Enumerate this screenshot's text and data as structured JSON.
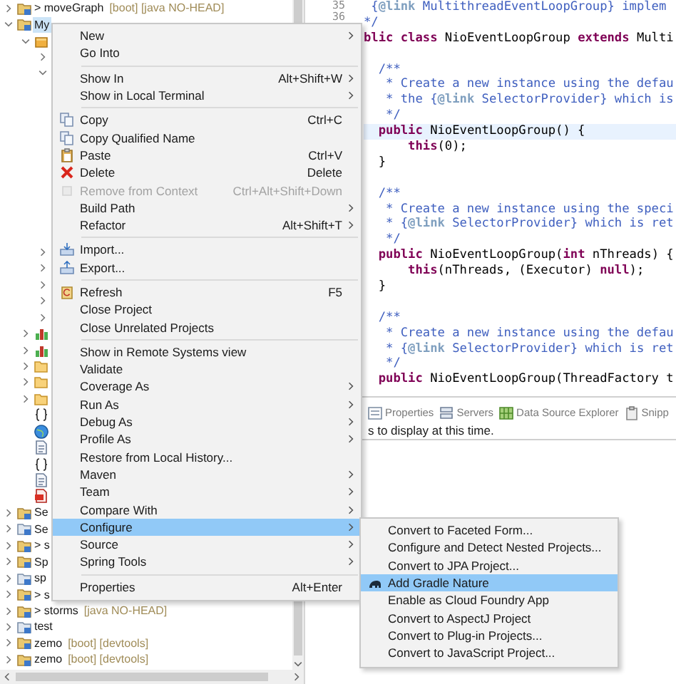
{
  "tree_top": [
    {
      "kind": "project",
      "label": "> moveGraph",
      "decoration": "[boot] [java NO-HEAD]",
      "expanded": false,
      "selected": false
    },
    {
      "kind": "project",
      "label": "My",
      "expanded": true,
      "selected": true,
      "children": [
        {
          "kind": "package",
          "expanded": true,
          "selected": false,
          "children": [
            {
              "expanded": false,
              "selected": false
            },
            {
              "expanded": true,
              "selected": false
            }
          ]
        }
      ]
    }
  ],
  "tree_bottom": [
    {
      "kind": "continued",
      "children": [
        {
          "kind": "continued",
          "children": [
            {
              "expanded": false,
              "selected": false
            },
            {
              "expanded": false,
              "selected": false
            },
            {
              "expanded": false,
              "selected": false
            },
            {
              "expanded": false,
              "selected": false
            },
            {
              "expanded": false,
              "selected": false
            }
          ]
        },
        {
          "kind": "chart",
          "expanded": false,
          "selected": false
        },
        {
          "kind": "chart",
          "expanded": false,
          "selected": false
        },
        {
          "kind": "folder",
          "expanded": false,
          "selected": false
        },
        {
          "kind": "folder",
          "expanded": false,
          "selected": false
        },
        {
          "kind": "folder",
          "expanded": false,
          "selected": false
        },
        {
          "kind": "braces",
          "selected": false
        },
        {
          "kind": "globe",
          "selected": false
        },
        {
          "kind": "file",
          "selected": false
        },
        {
          "kind": "braces",
          "selected": false
        },
        {
          "kind": "file",
          "selected": false
        },
        {
          "kind": "pdf",
          "selected": false
        }
      ]
    },
    {
      "kind": "project",
      "label": "Se",
      "expanded": false,
      "selected": false
    },
    {
      "kind": "project-alt",
      "label": "Se",
      "expanded": false,
      "selected": false
    },
    {
      "kind": "project",
      "label": "> s",
      "expanded": false,
      "selected": false
    },
    {
      "kind": "project",
      "label": "Sp",
      "expanded": false,
      "selected": false
    },
    {
      "kind": "project-alt",
      "label": "sp",
      "expanded": false,
      "selected": false
    },
    {
      "kind": "project",
      "label": "> s",
      "expanded": false,
      "selected": false
    },
    {
      "kind": "project",
      "label": "> storms",
      "decoration": "[java NO-HEAD]",
      "expanded": false,
      "selected": false
    },
    {
      "kind": "project-alt",
      "label": "test",
      "expanded": false,
      "selected": false
    },
    {
      "kind": "project",
      "label": "zemo",
      "decoration": "[boot] [devtools]",
      "expanded": false,
      "selected": false
    },
    {
      "kind": "project",
      "label": "zemo",
      "decoration": "[boot] [devtools]",
      "expanded": false,
      "selected": false
    }
  ],
  "line_numbers": [
    "35",
    "36"
  ],
  "code": [
    {
      "kind": "code",
      "current": false,
      "segments": [
        {
          "t": " {",
          "kind": "javadoc"
        },
        {
          "t": "@link",
          "kind": "javadoc-tag"
        },
        {
          "t": " MultithreadEventLoopGroup} implem",
          "kind": "javadoc"
        }
      ]
    },
    {
      "kind": "code",
      "current": false,
      "segments": [
        {
          "t": "*/",
          "kind": "javadoc"
        }
      ]
    },
    {
      "kind": "code",
      "current": false,
      "segments": [
        {
          "t": "blic",
          "kind": "keyword"
        },
        {
          "t": " class",
          "kind": "keyword"
        },
        {
          "t": " NioEventLoopGroup ",
          "kind": "plain"
        },
        {
          "t": "extends",
          "kind": "keyword"
        },
        {
          "t": " Multi",
          "kind": "plain"
        }
      ]
    },
    {
      "kind": "blank"
    },
    {
      "kind": "code",
      "current": false,
      "segments": [
        {
          "t": "  /**",
          "kind": "javadoc"
        }
      ]
    },
    {
      "kind": "code",
      "current": false,
      "segments": [
        {
          "t": "   * Create a new instance using the defau",
          "kind": "javadoc"
        }
      ]
    },
    {
      "kind": "code",
      "current": false,
      "segments": [
        {
          "t": "   * the {",
          "kind": "javadoc"
        },
        {
          "t": "@link",
          "kind": "javadoc-tag"
        },
        {
          "t": " SelectorProvider} which is",
          "kind": "javadoc"
        }
      ]
    },
    {
      "kind": "code",
      "current": false,
      "segments": [
        {
          "t": "   */",
          "kind": "javadoc"
        }
      ]
    },
    {
      "kind": "code",
      "current": true,
      "segments": [
        {
          "t": "  public",
          "kind": "keyword"
        },
        {
          "t": " NioEventLoopGroup() {",
          "kind": "plain"
        }
      ]
    },
    {
      "kind": "code",
      "current": false,
      "segments": [
        {
          "t": "      this",
          "kind": "keyword"
        },
        {
          "t": "(0);",
          "kind": "plain"
        }
      ]
    },
    {
      "kind": "code",
      "current": false,
      "segments": [
        {
          "t": "  }",
          "kind": "plain"
        }
      ]
    },
    {
      "kind": "blank"
    },
    {
      "kind": "code",
      "current": false,
      "segments": [
        {
          "t": "  /**",
          "kind": "javadoc"
        }
      ]
    },
    {
      "kind": "code",
      "current": false,
      "segments": [
        {
          "t": "   * Create a new instance using the speci",
          "kind": "javadoc"
        }
      ]
    },
    {
      "kind": "code",
      "current": false,
      "segments": [
        {
          "t": "   * {",
          "kind": "javadoc"
        },
        {
          "t": "@link",
          "kind": "javadoc-tag"
        },
        {
          "t": " SelectorProvider} which is ret",
          "kind": "javadoc"
        }
      ]
    },
    {
      "kind": "code",
      "current": false,
      "segments": [
        {
          "t": "   */",
          "kind": "javadoc"
        }
      ]
    },
    {
      "kind": "code",
      "current": false,
      "segments": [
        {
          "t": "  public",
          "kind": "keyword"
        },
        {
          "t": " NioEventLoopGroup(",
          "kind": "plain"
        },
        {
          "t": "int",
          "kind": "keyword"
        },
        {
          "t": " nThreads) {",
          "kind": "plain"
        }
      ]
    },
    {
      "kind": "code",
      "current": false,
      "segments": [
        {
          "t": "      this",
          "kind": "keyword"
        },
        {
          "t": "(nThreads, (Executor) ",
          "kind": "plain"
        },
        {
          "t": "null",
          "kind": "keyword"
        },
        {
          "t": ");",
          "kind": "plain"
        }
      ]
    },
    {
      "kind": "code",
      "current": false,
      "segments": [
        {
          "t": "  }",
          "kind": "plain"
        }
      ]
    },
    {
      "kind": "blank"
    },
    {
      "kind": "code",
      "current": false,
      "segments": [
        {
          "t": "  /**",
          "kind": "javadoc"
        }
      ]
    },
    {
      "kind": "code",
      "current": false,
      "segments": [
        {
          "t": "   * Create a new instance using the defau",
          "kind": "javadoc"
        }
      ]
    },
    {
      "kind": "code",
      "current": false,
      "segments": [
        {
          "t": "   * {",
          "kind": "javadoc"
        },
        {
          "t": "@link",
          "kind": "javadoc-tag"
        },
        {
          "t": " SelectorProvider} which is ret",
          "kind": "javadoc"
        }
      ]
    },
    {
      "kind": "code",
      "current": false,
      "segments": [
        {
          "t": "   */",
          "kind": "javadoc"
        }
      ]
    },
    {
      "kind": "code",
      "current": false,
      "segments": [
        {
          "t": "  public",
          "kind": "keyword"
        },
        {
          "t": " NioEventLoopGroup(ThreadFactory t",
          "kind": "plain"
        }
      ]
    }
  ],
  "bottom_panel": {
    "tabs": [
      {
        "kind": "properties",
        "label": "Properties",
        "selected": false
      },
      {
        "kind": "servers",
        "label": "Servers",
        "selected": false
      },
      {
        "kind": "datasource",
        "label": "Data Source Explorer",
        "selected": false
      },
      {
        "kind": "snippets",
        "label": "Snipp",
        "selected": false
      }
    ],
    "message": "s to display at this time."
  },
  "context_menu": [
    {
      "kind": "item",
      "label": "New",
      "submenu": true,
      "selected": false,
      "disabled": false
    },
    {
      "kind": "item",
      "label": "Go Into",
      "submenu": false,
      "selected": false,
      "disabled": false
    },
    {
      "kind": "separator"
    },
    {
      "kind": "item",
      "label": "Show In",
      "shortcut": "Alt+Shift+W",
      "submenu": true,
      "selected": false,
      "disabled": false
    },
    {
      "kind": "item",
      "label": "Show in Local Terminal",
      "submenu": true,
      "selected": false,
      "disabled": false
    },
    {
      "kind": "separator"
    },
    {
      "kind": "copy",
      "label": "Copy",
      "shortcut": "Ctrl+C",
      "submenu": false,
      "selected": false,
      "disabled": false
    },
    {
      "kind": "copy",
      "label": "Copy Qualified Name",
      "submenu": false,
      "selected": false,
      "disabled": false
    },
    {
      "kind": "paste",
      "label": "Paste",
      "shortcut": "Ctrl+V",
      "submenu": false,
      "selected": false,
      "disabled": false
    },
    {
      "kind": "delete",
      "label": "Delete",
      "shortcut": "Delete",
      "submenu": false,
      "selected": false,
      "disabled": false
    },
    {
      "kind": "remove",
      "label": "Remove from Context",
      "shortcut": "Ctrl+Alt+Shift+Down",
      "submenu": false,
      "selected": false,
      "disabled": true
    },
    {
      "kind": "item",
      "label": "Build Path",
      "submenu": true,
      "selected": false,
      "disabled": false
    },
    {
      "kind": "item",
      "label": "Refactor",
      "shortcut": "Alt+Shift+T",
      "submenu": true,
      "selected": false,
      "disabled": false
    },
    {
      "kind": "separator"
    },
    {
      "kind": "import",
      "label": "Import...",
      "submenu": false,
      "selected": false,
      "disabled": false
    },
    {
      "kind": "export",
      "label": "Export...",
      "submenu": false,
      "selected": false,
      "disabled": false
    },
    {
      "kind": "separator"
    },
    {
      "kind": "refresh",
      "label": "Refresh",
      "shortcut": "F5",
      "submenu": false,
      "selected": false,
      "disabled": false
    },
    {
      "kind": "item",
      "label": "Close Project",
      "submenu": false,
      "selected": false,
      "disabled": false
    },
    {
      "kind": "item",
      "label": "Close Unrelated Projects",
      "submenu": false,
      "selected": false,
      "disabled": false
    },
    {
      "kind": "separator"
    },
    {
      "kind": "item",
      "label": "Show in Remote Systems view",
      "submenu": false,
      "selected": false,
      "disabled": false
    },
    {
      "kind": "item",
      "label": "Validate",
      "submenu": false,
      "selected": false,
      "disabled": false
    },
    {
      "kind": "item",
      "label": "Coverage As",
      "submenu": true,
      "selected": false,
      "disabled": false
    },
    {
      "kind": "item",
      "label": "Run As",
      "submenu": true,
      "selected": false,
      "disabled": false
    },
    {
      "kind": "item",
      "label": "Debug As",
      "submenu": true,
      "selected": false,
      "disabled": false
    },
    {
      "kind": "item",
      "label": "Profile As",
      "submenu": true,
      "selected": false,
      "disabled": false
    },
    {
      "kind": "item",
      "label": "Restore from Local History...",
      "submenu": false,
      "selected": false,
      "disabled": false
    },
    {
      "kind": "item",
      "label": "Maven",
      "submenu": true,
      "selected": false,
      "disabled": false
    },
    {
      "kind": "item",
      "label": "Team",
      "submenu": true,
      "selected": false,
      "disabled": false
    },
    {
      "kind": "item",
      "label": "Compare With",
      "submenu": true,
      "selected": false,
      "disabled": false
    },
    {
      "kind": "item",
      "label": "Configure",
      "submenu": true,
      "selected": true,
      "disabled": false
    },
    {
      "kind": "item",
      "label": "Source",
      "submenu": true,
      "selected": false,
      "disabled": false
    },
    {
      "kind": "item",
      "label": "Spring Tools",
      "submenu": true,
      "selected": false,
      "disabled": false
    },
    {
      "kind": "separator"
    },
    {
      "kind": "item",
      "label": "Properties",
      "shortcut": "Alt+Enter",
      "submenu": false,
      "selected": false,
      "disabled": false
    }
  ],
  "configure_submenu": [
    {
      "kind": "item",
      "label": "Convert to Faceted Form...",
      "selected": false
    },
    {
      "kind": "item",
      "label": "Configure and Detect Nested Projects...",
      "selected": false
    },
    {
      "kind": "item",
      "label": "Convert to JPA Project...",
      "selected": false
    },
    {
      "kind": "gradle",
      "label": "Add Gradle Nature",
      "selected": true
    },
    {
      "kind": "item",
      "label": "Enable as Cloud Foundry App",
      "selected": false
    },
    {
      "kind": "item",
      "label": "Convert to AspectJ Project",
      "selected": false
    },
    {
      "kind": "item",
      "label": "Convert to Plug-in Projects...",
      "selected": false
    },
    {
      "kind": "item",
      "label": "Convert to JavaScript Project...",
      "selected": false
    }
  ]
}
